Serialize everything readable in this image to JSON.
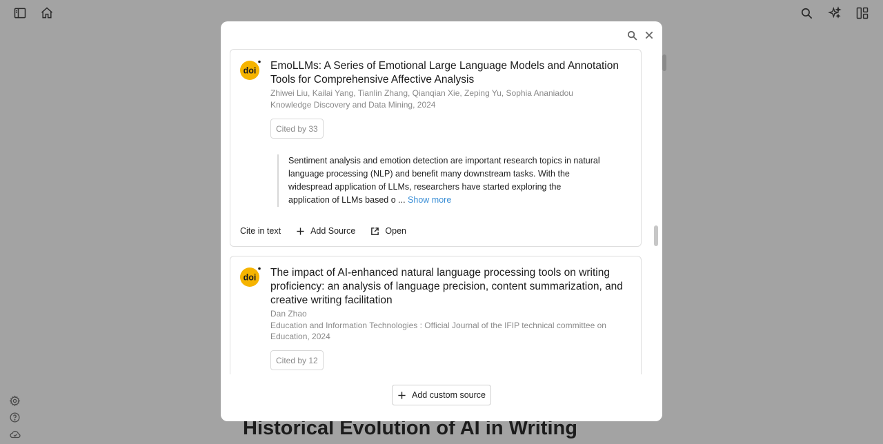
{
  "topbar": {
    "left_icons": [
      "sidebar-toggle-icon",
      "home-icon"
    ],
    "right_icons": [
      "search-icon",
      "ai-sparkle-icon",
      "layout-icon"
    ]
  },
  "background": {
    "heading": "Historical Evolution of AI in Writing"
  },
  "sidebar_bottom_icons": [
    "settings-icon",
    "help-icon",
    "cloud-icon"
  ],
  "modal": {
    "header_icons": [
      "search-icon",
      "close-icon"
    ],
    "sources": [
      {
        "logo": "doi",
        "title": "EmoLLMs: A Series of Emotional Large Language Models and Annotation Tools for Comprehensive Affective Analysis",
        "authors": "Zhiwei Liu, Kailai Yang, Tianlin Zhang, Qianqian Xie, Zeping Yu, Sophia Ananiadou",
        "venue": "Knowledge Discovery and Data Mining, 2024",
        "cited_by": "Cited by 33",
        "abstract": "Sentiment analysis and emotion detection are important research topics in natural language processing (NLP) and benefit many downstream tasks. With the widespread application of LLMs, researchers have started exploring the application of LLMs based o ...",
        "show_more": "Show more",
        "actions": {
          "cite": "Cite in text",
          "add": "Add Source",
          "open": "Open"
        }
      },
      {
        "logo": "doi",
        "title": "The impact of AI-enhanced natural language processing tools on writing proficiency: an analysis of language precision, content summarization, and creative writing facilitation",
        "authors": "Dan Zhao",
        "venue": "Education and Information Technologies : Official Journal of the IFIP technical committee on Education, 2024",
        "cited_by": "Cited by 12"
      }
    ],
    "footer": {
      "add_custom_label": "Add custom source"
    }
  }
}
